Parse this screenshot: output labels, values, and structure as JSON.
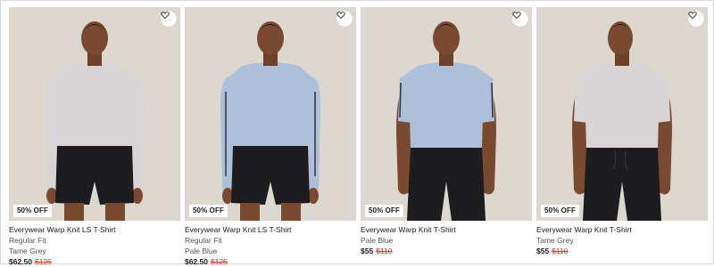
{
  "colors": {
    "background": "#ffffff",
    "image_background": "#dcd7cf",
    "sale_price": "#1a1a1a",
    "original_price": "#d0352b",
    "tame_grey": "#d9d5d6",
    "pale_blue": "#aebfd9",
    "shorts": "#1d1d1f"
  },
  "products": [
    {
      "title": "Everywear Warp Knit LS T-Shirt",
      "fit": "Regular Fit",
      "color_name": "Tame Grey",
      "sale_price": "$62.50",
      "original_price": "$125",
      "discount_badge": "50% OFF",
      "wishlist_icon": "heart-outline-icon",
      "image": "model-wearing-long-sleeve-grey-shirt"
    },
    {
      "title": "Everywear Warp Knit LS T-Shirt",
      "fit": "Regular Fit",
      "color_name": "Pale Blue",
      "sale_price": "$62.50",
      "original_price": "$125",
      "discount_badge": "50% OFF",
      "wishlist_icon": "heart-outline-icon",
      "image": "model-wearing-long-sleeve-blue-shirt"
    },
    {
      "title": "Everywear Warp Knit T-Shirt",
      "color_name": "Pale Blue",
      "sale_price": "$55",
      "original_price": "$110",
      "discount_badge": "50% OFF",
      "wishlist_icon": "heart-outline-icon",
      "image": "model-wearing-short-sleeve-blue-shirt"
    },
    {
      "title": "Everywear Warp Knit T-Shirt",
      "color_name": "Tame Grey",
      "sale_price": "$55",
      "original_price": "$110",
      "discount_badge": "50% OFF",
      "wishlist_icon": "heart-outline-icon",
      "image": "model-wearing-short-sleeve-grey-shirt"
    }
  ]
}
